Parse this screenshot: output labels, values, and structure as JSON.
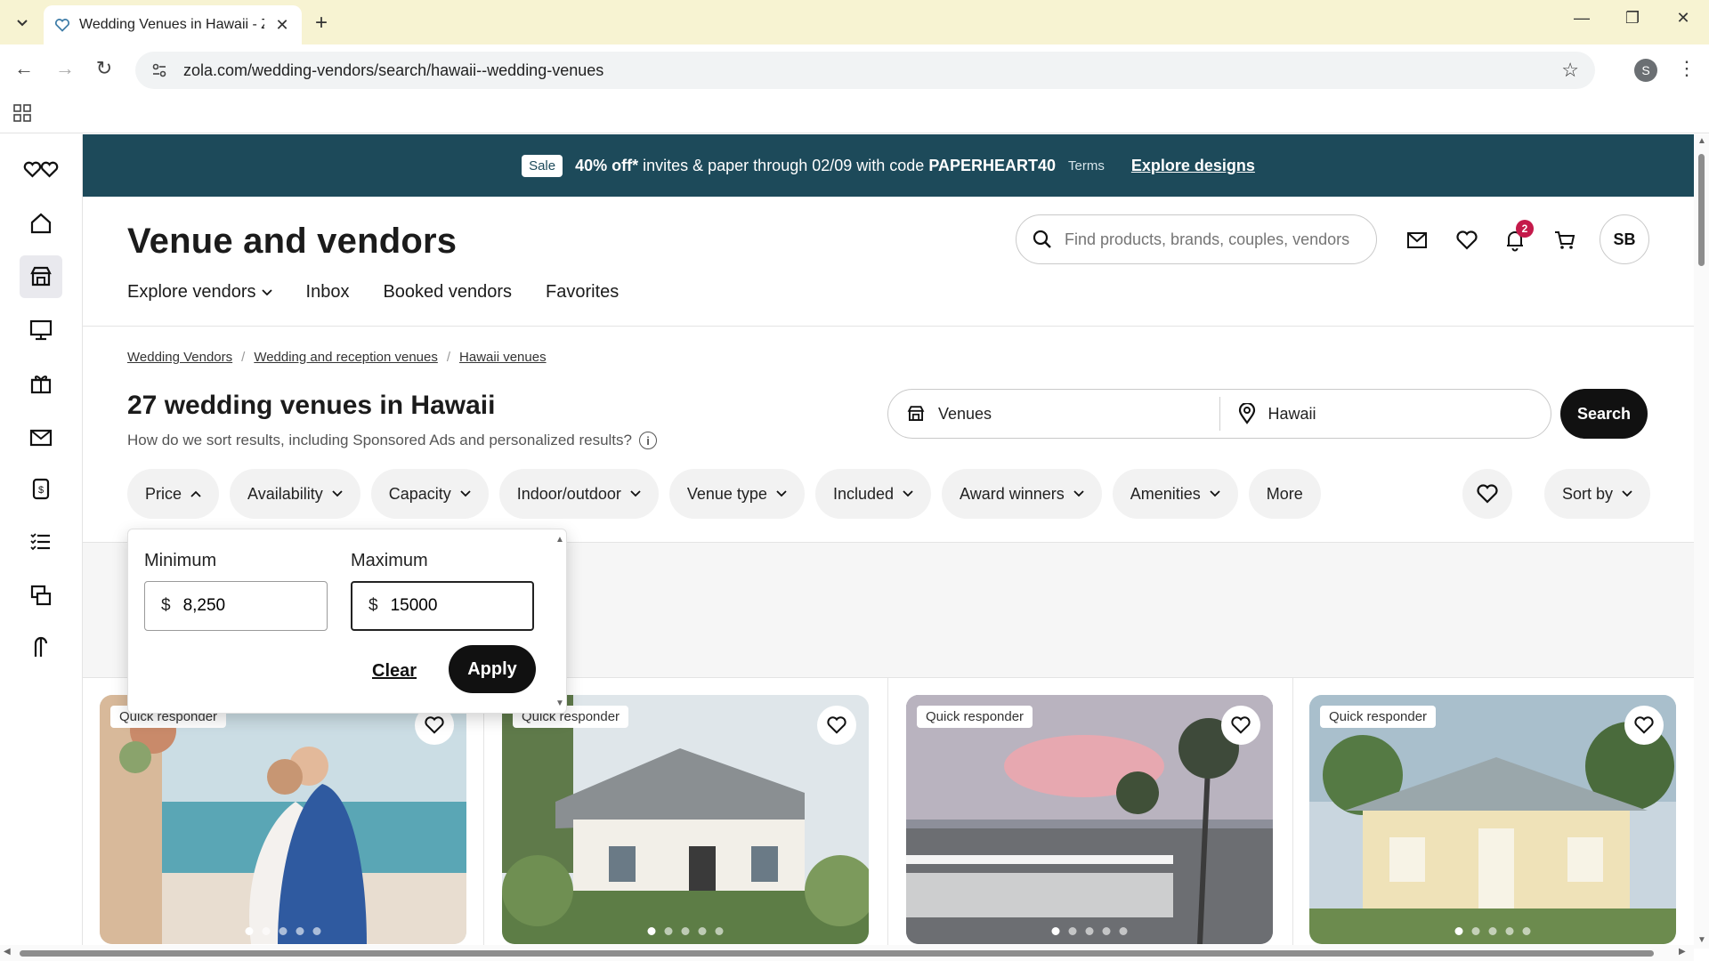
{
  "browser": {
    "tab_title": "Wedding Venues in Hawaii - Zo",
    "url": "zola.com/wedding-vendors/search/hawaii--wedding-venues",
    "profile_initial": "S"
  },
  "promo": {
    "sale_label": "Sale",
    "offer": "40% off*",
    "text_part1": " invites & paper through 02/09 with code ",
    "code": "PAPERHEART40",
    "terms": "Terms",
    "link": "Explore designs"
  },
  "header": {
    "title": "Venue and vendors",
    "search_placeholder": "Find products, brands, couples, vendors...",
    "notification_count": "2",
    "avatar_initials": "SB",
    "subnav": {
      "explore": "Explore vendors",
      "inbox": "Inbox",
      "booked": "Booked vendors",
      "favorites": "Favorites"
    }
  },
  "breadcrumbs": [
    "Wedding Vendors",
    "Wedding and reception venues",
    "Hawaii venues"
  ],
  "results": {
    "title": "27 wedding venues in Hawaii",
    "subtitle": "How do we sort results, including Sponsored Ads and personalized results?"
  },
  "venue_search": {
    "category": "Venues",
    "location": "Hawaii",
    "button": "Search"
  },
  "filters": [
    "Price",
    "Availability",
    "Capacity",
    "Indoor/outdoor",
    "Venue type",
    "Included",
    "Award winners",
    "Amenities",
    "More"
  ],
  "sort_label": "Sort by",
  "price_popover": {
    "min_label": "Minimum",
    "max_label": "Maximum",
    "currency": "$",
    "min_value": "8,250",
    "max_value": "15000",
    "clear": "Clear",
    "apply": "Apply"
  },
  "cards": [
    {
      "badge": "Quick responder"
    },
    {
      "badge": "Quick responder"
    },
    {
      "badge": "Quick responder"
    },
    {
      "badge": "Quick responder"
    }
  ]
}
